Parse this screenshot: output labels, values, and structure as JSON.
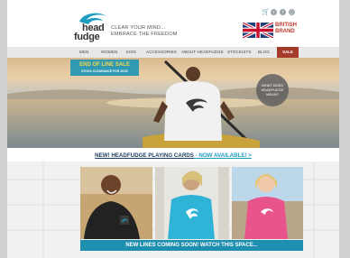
{
  "header": {
    "logo_line1": "head",
    "logo_line2": "fudge",
    "tagline_line1": "CLEAR YOUR MIND...",
    "tagline_line2": "EMBRACE THE FREEDOM",
    "brand_line1": "BRITISH",
    "brand_line2": "BRAND",
    "cart_icon": "cart-icon",
    "social_icons": [
      "twitter-icon",
      "facebook-icon",
      "instagram-icon"
    ]
  },
  "nav": {
    "items": [
      "MEN",
      "WOMEN",
      "KIDS",
      "ACCESSORIES",
      "ABOUT HEADFUDGE",
      "STOCKISTS",
      "BLOG",
      "SALE"
    ]
  },
  "hero": {
    "sale_title": "END OF LINE SALE",
    "sale_sub": "STOCK CLEARANCE FOR 2015!",
    "circle_text_1": "WHAT DOES",
    "circle_text_2": "HEADFUDGE",
    "circle_text_3": "MEAN?"
  },
  "promo": {
    "part1": "NEW! HEADFUDGE PLAYING CARDS",
    "part2": " - NOW AVAILABLE! >"
  },
  "gallery": {
    "caption": "NEW LINES COMING SOON! WATCH THIS SPACE..."
  },
  "colors": {
    "accent": "#1f8fb0",
    "sale_red": "#a33a2a",
    "navy": "#1c3e63"
  }
}
